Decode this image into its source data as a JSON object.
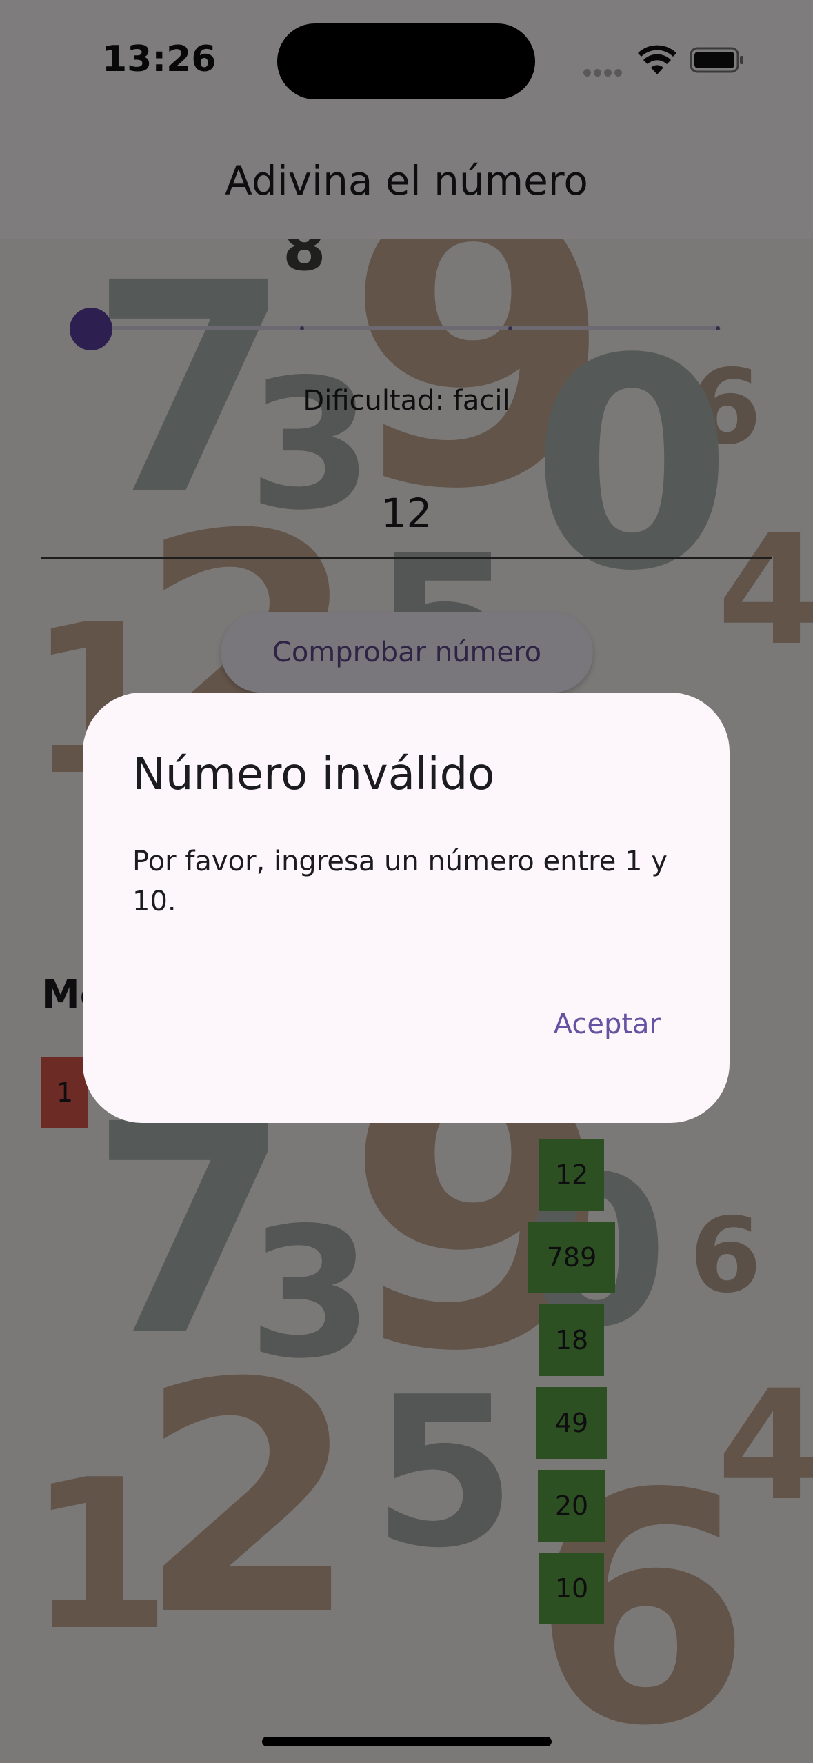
{
  "status_bar": {
    "time": "13:26"
  },
  "app_bar": {
    "title": "Adivina el número"
  },
  "background": {
    "digits": [
      "8",
      "9",
      "7",
      "3",
      "6",
      "2",
      "5",
      "0",
      "1",
      "4",
      "9",
      "7",
      "3",
      "6",
      "2",
      "5",
      "1",
      "4",
      "6",
      "0"
    ]
  },
  "controls": {
    "difficulty_label": "Dificultad: facil",
    "number_value": "12",
    "check_button": "Comprobar número"
  },
  "attempts": {
    "heading": "Me",
    "wrong": [
      "1"
    ],
    "correct": [
      "12",
      "789",
      "18",
      "49",
      "20",
      "10"
    ]
  },
  "dialog": {
    "title": "Número inválido",
    "message": "Por favor, ingresa un número entre 1 y 10.",
    "accept_button": "Aceptar"
  },
  "colors": {
    "accent": "#5b3fa1",
    "dialog_background": "#fdf7fc",
    "wrong_chip": "#d9574a",
    "correct_chip": "#5aa044",
    "scrim": "rgba(0,0,0,0.5)"
  }
}
